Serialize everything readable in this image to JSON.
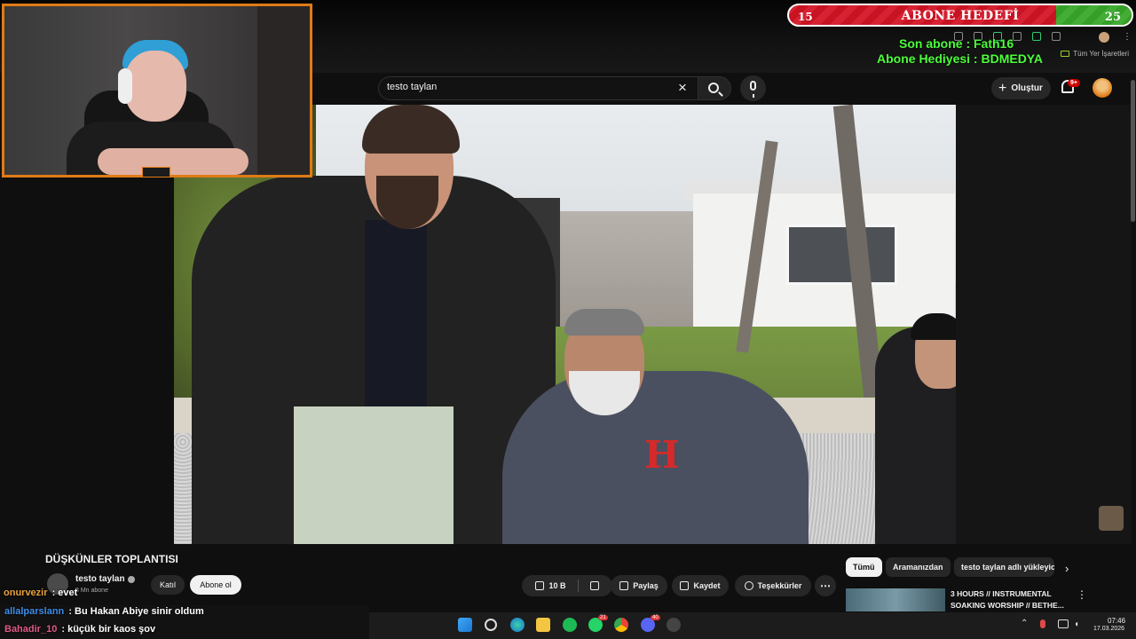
{
  "stream_overlay": {
    "goal": {
      "label": "ABONE HEDEFİ",
      "min": "15",
      "max": "25"
    },
    "last_sub": "Son abone : Fath16",
    "gift_sub": "Abone Hediyesi : BDMEDYA"
  },
  "browser": {
    "bookmarks_label": "Tüm Yer İşaretleri"
  },
  "youtube": {
    "search": {
      "value": "testo taylan"
    },
    "create_label": "Oluştur",
    "notifications_badge": "9+",
    "video": {
      "title": "DÜŞKÜNLER TOPLANTISI",
      "channel": "testo taylan",
      "subscribers": "8 Mn abone",
      "join_label": "Katıl",
      "subscribe_label": "Abone ol",
      "likes": "10 B",
      "share_label": "Paylaş",
      "save_label": "Kaydet",
      "thanks_label": "Teşekkürler",
      "more_label": "⋯"
    },
    "chips": [
      "Tümü",
      "Aramanızdan",
      "testo taylan adlı yükleyici"
    ],
    "recommendation": {
      "title": "3 HOURS // INSTRUMENTAL SOAKING WORSHIP // BETHE..."
    }
  },
  "chat": [
    {
      "user": "onurvezir",
      "message": "evet",
      "color": "#e8a23c"
    },
    {
      "user": "allalparslann",
      "message": "Bu Hakan Abiye sinir oldum",
      "color": "#3c8de8"
    },
    {
      "user": "Bahadir_10",
      "message": "küçük bir kaos şov",
      "color": "#e05a8a"
    }
  ],
  "taskbar": {
    "whatsapp_badge": "21",
    "discord_badge": "40",
    "time": "07:46",
    "date": "17.03.2026"
  },
  "colors": {
    "goal_red": "#d31425",
    "goal_green": "#38a82a",
    "overlay_green": "#4cff3b",
    "webcam_border": "#e07b16"
  }
}
